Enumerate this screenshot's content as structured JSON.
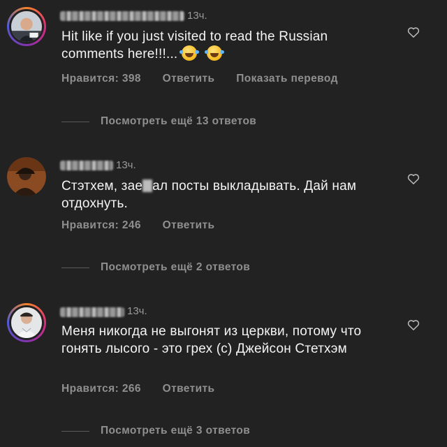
{
  "comments": [
    {
      "time": "13ч.",
      "text": "Hit like if you just visited to read the Russian comments here!!!...",
      "emojis": [
        "face-with-tears-of-joy",
        "face-with-tears-of-joy"
      ],
      "likes": "Нравится: 398",
      "reply": "Ответить",
      "translate": "Показать перевод",
      "view_more": "Посмотреть ещё 13 ответов"
    },
    {
      "time": "13ч.",
      "text_before": "Стэтхем, зае",
      "text_after": "ал посты выкладывать. Дай нам отдохнуть.",
      "likes": "Нравится: 246",
      "reply": "Ответить",
      "view_more": "Посмотреть ещё 2 ответов"
    },
    {
      "time": "13ч.",
      "text": "Меня никогда не выгонят из церкви, потому что гонять лысого - это грех (с) Джейсон Стетхэм",
      "likes": "Нравится: 266",
      "reply": "Ответить",
      "view_more": "Посмотреть ещё 3 ответов"
    }
  ],
  "colors": {
    "background": "#222222",
    "text": "#f4f4f4",
    "muted": "#8f8f8f"
  }
}
